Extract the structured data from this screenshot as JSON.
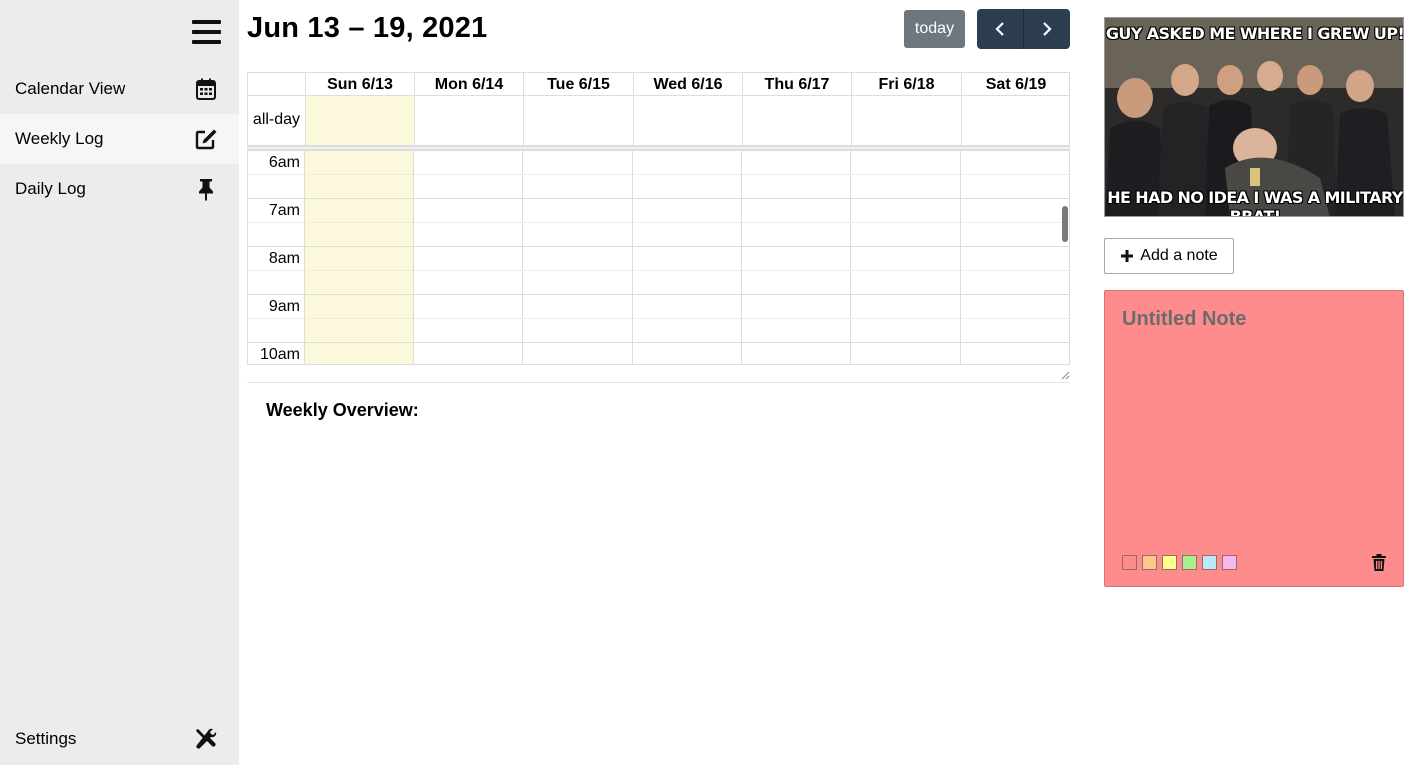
{
  "sidebar": {
    "items": [
      {
        "label": "Calendar View",
        "icon": "calendar-icon",
        "active": false
      },
      {
        "label": "Weekly Log",
        "icon": "edit-icon",
        "active": true
      },
      {
        "label": "Daily Log",
        "icon": "pin-icon",
        "active": false
      }
    ],
    "settings_label": "Settings"
  },
  "header": {
    "title": "Jun 13 – 19, 2021",
    "today_label": "today"
  },
  "calendar": {
    "days": [
      "Sun 6/13",
      "Mon 6/14",
      "Tue 6/15",
      "Wed 6/16",
      "Thu 6/17",
      "Fri 6/18",
      "Sat 6/19"
    ],
    "today_index": 0,
    "allday_label": "all-day",
    "times": [
      "6am",
      "7am",
      "8am",
      "9am",
      "10am"
    ],
    "today_color": "#fcf8dc"
  },
  "overview": {
    "label": "Weekly Overview:"
  },
  "meme": {
    "top_text": "GUY ASKED ME WHERE I GREW UP!",
    "bottom_text": "HE HAD NO IDEA I WAS A MILITARY BRAT!"
  },
  "notes": {
    "add_label": "Add a note",
    "note_title": "Untitled Note",
    "note_color": "#fe8c8c",
    "swatches": [
      "#fe8c8c",
      "#ffc78c",
      "#ffff8c",
      "#a8f08c",
      "#b8eaf7",
      "#f7b8f2"
    ]
  }
}
